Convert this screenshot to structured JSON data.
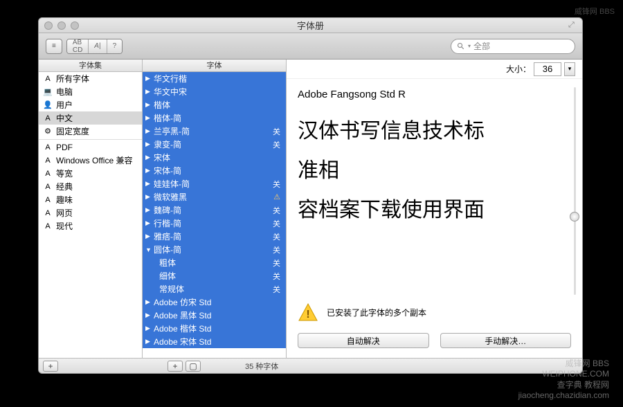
{
  "window": {
    "title": "字体册"
  },
  "search": {
    "placeholder": "全部"
  },
  "columns": {
    "collections": "字体集",
    "fonts": "字体"
  },
  "collections": {
    "items": [
      {
        "icon": "A",
        "label": "所有字体"
      },
      {
        "icon": "💻",
        "label": "电脑"
      },
      {
        "icon": "👤",
        "label": "用户"
      },
      {
        "icon": "A",
        "label": "中文",
        "selected": true
      },
      {
        "icon": "⚙",
        "label": "固定宽度"
      },
      {
        "icon": "A",
        "label": "PDF",
        "sep": true
      },
      {
        "icon": "A",
        "label": "Windows Office 兼容"
      },
      {
        "icon": "A",
        "label": "等宽"
      },
      {
        "icon": "A",
        "label": "经典"
      },
      {
        "icon": "A",
        "label": "趣味"
      },
      {
        "icon": "A",
        "label": "网页"
      },
      {
        "icon": "A",
        "label": "现代"
      }
    ]
  },
  "fonts": {
    "items": [
      {
        "label": "华文行楷",
        "tri": "▶"
      },
      {
        "label": "华文中宋",
        "tri": "▶"
      },
      {
        "label": "楷体",
        "tri": "▶"
      },
      {
        "label": "楷体-简",
        "tri": "▶"
      },
      {
        "label": "兰亭黑-简",
        "tri": "▶",
        "badge": "关"
      },
      {
        "label": "隶变-简",
        "tri": "▶",
        "badge": "关"
      },
      {
        "label": "宋体",
        "tri": "▶"
      },
      {
        "label": "宋体-简",
        "tri": "▶"
      },
      {
        "label": "娃娃体-简",
        "tri": "▶",
        "badge": "关"
      },
      {
        "label": "微软雅黑",
        "tri": "▶",
        "badge": "⚠"
      },
      {
        "label": "魏碑-简",
        "tri": "▶",
        "badge": "关"
      },
      {
        "label": "行楷-简",
        "tri": "▶",
        "badge": "关"
      },
      {
        "label": "雅痞-简",
        "tri": "▶",
        "badge": "关"
      },
      {
        "label": "圆体-简",
        "tri": "▼",
        "badge": "关"
      },
      {
        "label": "粗体",
        "sub": true,
        "badge": "关"
      },
      {
        "label": "细体",
        "sub": true,
        "badge": "关"
      },
      {
        "label": "常规体",
        "sub": true,
        "badge": "关"
      },
      {
        "label": "Adobe 仿宋 Std",
        "tri": "▶"
      },
      {
        "label": "Adobe 黑体 Std",
        "tri": "▶"
      },
      {
        "label": "Adobe 楷体 Std",
        "tri": "▶"
      },
      {
        "label": "Adobe 宋体 Std",
        "tri": "▶"
      }
    ]
  },
  "preview": {
    "sizeLabel": "大小：",
    "size": "36",
    "fontName": "Adobe Fangsong Std R",
    "sample1": "汉体书写信息技术标",
    "sample2": "准相",
    "sample3": "容档案下载使用界面"
  },
  "warning": {
    "text": "已安装了此字体的多个副本"
  },
  "buttons": {
    "auto": "自动解决",
    "manual": "手动解决…"
  },
  "footer": {
    "status": "35 种字体"
  },
  "watermarks": {
    "a": "威锋网 BBS",
    "b": "WEIPHONE.COM",
    "c": "查字典 教程网",
    "d": "jiaocheng.chazidian.com"
  }
}
